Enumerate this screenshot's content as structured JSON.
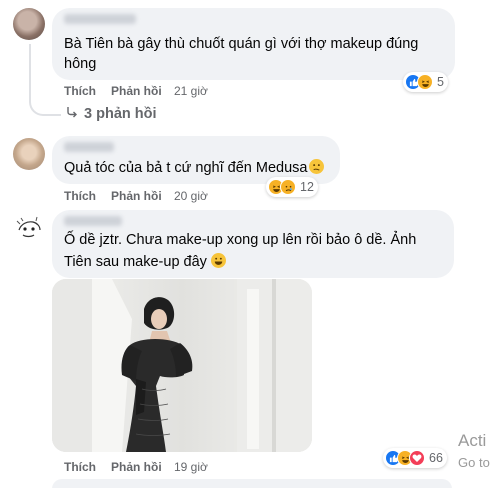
{
  "comments": [
    {
      "text": [
        "Bà Tiên bà gây thù chuốt quán gì với thợ makeup đúng",
        "hông"
      ],
      "like_label": "Thích",
      "reply_label": "Phản hồi",
      "time": "21 giờ",
      "reaction_count": "5",
      "reactions": [
        "like-icon",
        "haha-icon"
      ]
    },
    {
      "text": [
        "Quả tóc của bả t cứ nghĩ đến Medusa"
      ],
      "like_label": "Thích",
      "reply_label": "Phản hồi",
      "time": "20 giờ",
      "reaction_count": "12",
      "reactions": [
        "haha-icon",
        "sad-icon"
      ]
    },
    {
      "text": [
        "Ố dề jztr. Chưa make-up xong up lên rồi bảo ô dề. Ảnh",
        "Tiên sau make-up đây"
      ],
      "like_label": "Thích",
      "reply_label": "Phản hồi",
      "time": "19 giờ",
      "reaction_count": "66",
      "reactions": [
        "like-icon",
        "haha-icon",
        "love-icon"
      ]
    }
  ],
  "replies_link": "3 phản hồi",
  "watermark": [
    "Acti",
    "Go to"
  ],
  "colors": {
    "bubble": "#f0f2f5",
    "meta_text": "#65676b",
    "like_blue": "#1877f2",
    "emoji_yellow": "#f7b125",
    "love_red": "#f33e58"
  }
}
